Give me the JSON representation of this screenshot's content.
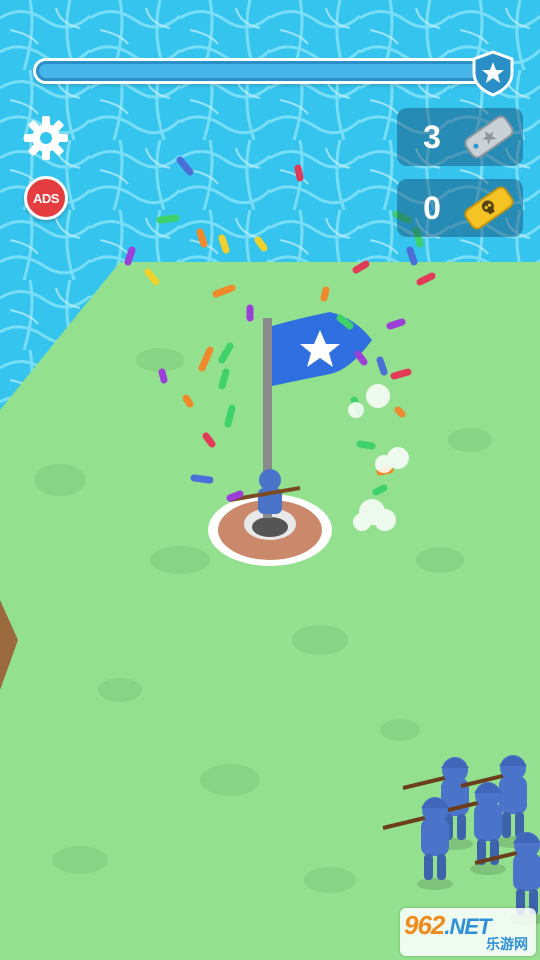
{
  "progress": {
    "level": 0.99
  },
  "counters": {
    "silver": {
      "value": "3",
      "icon": "silver-ticket-icon"
    },
    "gold": {
      "value": "0",
      "icon": "skull-ticket-icon"
    }
  },
  "buttons": {
    "settings_icon": "gear-icon",
    "ads_label": "ADS"
  },
  "watermark": {
    "main": "962",
    "suffix": ".NET",
    "sub": "乐游网"
  },
  "colors": {
    "water": "#35c4ee",
    "ground": "#93e08f",
    "flag": "#2f6fe0",
    "soldier": "#4a74c9",
    "ads": "#e53c3f"
  }
}
